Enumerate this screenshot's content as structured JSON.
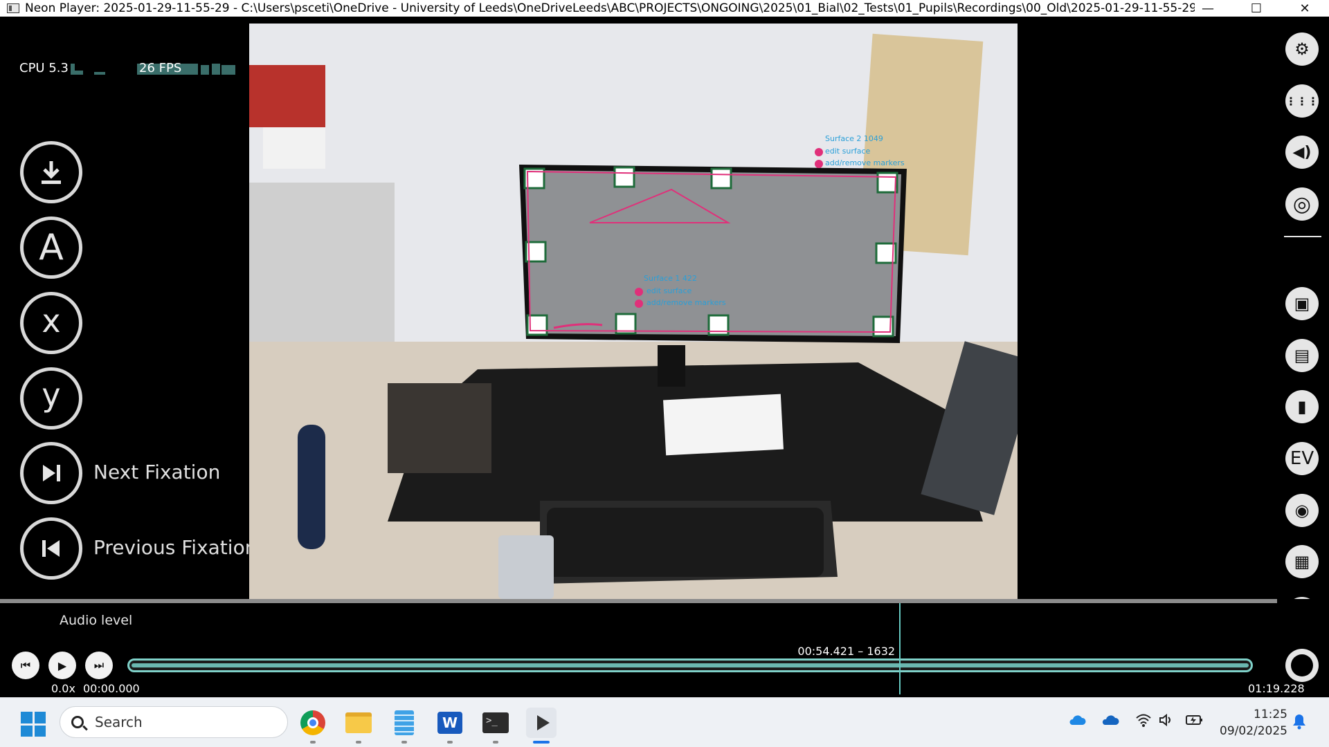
{
  "window": {
    "title": "Neon Player: 2025-01-29-11-55-29 - C:\\Users\\psceti\\OneDrive - University of Leeds\\OneDriveLeeds\\ABC\\PROJECTS\\ONGOING\\2025\\01_Bial\\02_Tests\\01_Pupils\\Recordings\\00_Old\\2025-01-29-11-55-29\\neon_...",
    "minimize": "—",
    "maximize": "☐",
    "close": "✕"
  },
  "perf": {
    "cpu": "CPU 5.3",
    "fps": "26 FPS"
  },
  "left_buttons": [
    {
      "icon": "download-icon",
      "glyph": "⤓"
    },
    {
      "icon": "letter-a-icon",
      "glyph": "A"
    },
    {
      "icon": "letter-x-icon",
      "glyph": "x"
    },
    {
      "icon": "letter-y-icon",
      "glyph": "y"
    },
    {
      "icon": "next-fixation-icon",
      "glyph": "⏭",
      "label": "Next Fixation"
    },
    {
      "icon": "previous-fixation-icon",
      "glyph": "⏮",
      "label": "Previous Fixation"
    }
  ],
  "video_overlay": {
    "surface1": {
      "name": "Surface 1",
      "count": "422",
      "edit": "edit surface",
      "markers": "add/remove markers"
    },
    "surface2": {
      "name": "Surface 2",
      "count": "1049",
      "edit": "edit surface",
      "markers": "add/remove markers"
    },
    "overlay_color": "#e0307a",
    "text_color": "#2a9fd8"
  },
  "right_buttons": [
    {
      "icon": "gear-icon",
      "glyph": "⚙"
    },
    {
      "icon": "plugins-grid-icon",
      "glyph": "⋮⋮⋮"
    },
    {
      "icon": "speaker-icon",
      "glyph": "🔊"
    },
    {
      "icon": "record-target-icon",
      "glyph": "◎"
    },
    {
      "icon": "surface-tracker-icon",
      "glyph": "▣"
    },
    {
      "icon": "document-icon",
      "glyph": "▤"
    },
    {
      "icon": "bookmark-icon",
      "glyph": "▮"
    },
    {
      "icon": "ev-icon",
      "glyph": "EV"
    },
    {
      "icon": "eye-overlay-icon",
      "glyph": "◉"
    },
    {
      "icon": "export-document-icon",
      "glyph": "▦"
    },
    {
      "icon": "screenshot-icon",
      "glyph": "⊡"
    }
  ],
  "timeline": {
    "audio_label": "Audio level",
    "cursor_label": "00:54.421 – 1632",
    "speed": "0.0x",
    "start_time": "00:00.000",
    "end_time": "01:19.228",
    "position_fraction": 0.686,
    "accent": "#7fd1c9"
  },
  "taskbar": {
    "search_placeholder": "Search",
    "apps": [
      "chrome-icon",
      "file-explorer-icon",
      "notepad-icon",
      "word-icon",
      "terminal-icon",
      "neon-player-icon"
    ],
    "time": "11:25",
    "date": "09/02/2025"
  }
}
